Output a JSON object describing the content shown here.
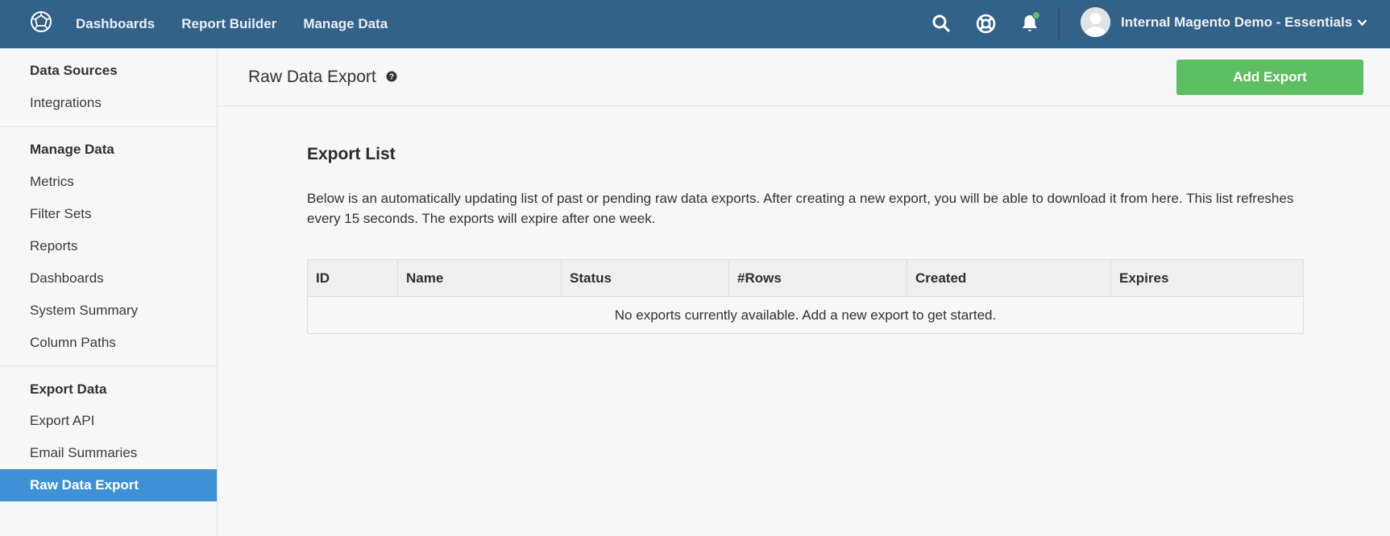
{
  "topbar": {
    "logo_icon": "magento-bi-logo-icon",
    "nav": [
      "Dashboards",
      "Report Builder",
      "Manage Data"
    ],
    "icons": [
      "search-icon",
      "help-lifebuoy-icon",
      "bell-icon"
    ],
    "notification_dot_color": "#5cc35f",
    "account_name": "Internal Magento Demo - Essentials"
  },
  "sidebar": {
    "sections": [
      {
        "title": "Data Sources",
        "items": [
          "Integrations"
        ]
      },
      {
        "title": "Manage Data",
        "items": [
          "Metrics",
          "Filter Sets",
          "Reports",
          "Dashboards",
          "System Summary",
          "Column Paths"
        ]
      },
      {
        "title": "Export Data",
        "items": [
          "Export API",
          "Email Summaries",
          "Raw Data Export"
        ]
      }
    ],
    "active_item": "Raw Data Export"
  },
  "header": {
    "title": "Raw Data Export",
    "add_button": "Add Export"
  },
  "main": {
    "section_title": "Export List",
    "description": "Below is an automatically updating list of past or pending raw data exports. After creating a new export, you will be able to download it from here. This list refreshes every 15 seconds. The exports will expire after one week.",
    "table": {
      "columns": [
        "ID",
        "Name",
        "Status",
        "#Rows",
        "Created",
        "Expires"
      ],
      "empty_message": "No exports currently available. Add a new export to get started."
    }
  },
  "colors": {
    "topbar": "#336289",
    "accent_active": "#3e91d6",
    "primary_button": "#5cbf61"
  }
}
